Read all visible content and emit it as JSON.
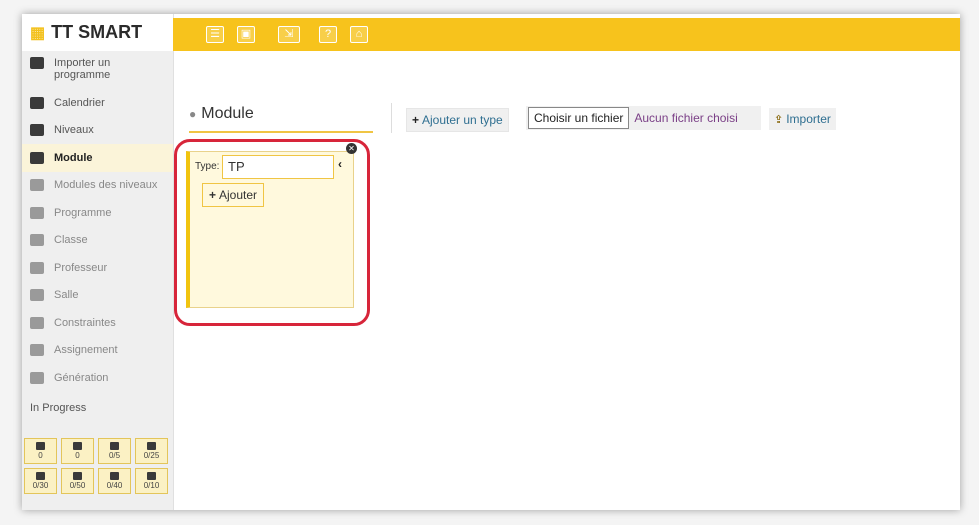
{
  "app": {
    "title": "TT SMART"
  },
  "sidebar": {
    "items": [
      {
        "label": "Importer un programme",
        "icon": "import-icon"
      },
      {
        "label": "Calendrier",
        "icon": "calendar-icon"
      },
      {
        "label": "Niveaux",
        "icon": "layers-icon"
      },
      {
        "label": "Module",
        "icon": "book-icon"
      },
      {
        "label": "Modules des niveaux",
        "icon": "sitemap-icon"
      },
      {
        "label": "Programme",
        "icon": "pen-icon"
      },
      {
        "label": "Classe",
        "icon": "users-icon"
      },
      {
        "label": "Professeur",
        "icon": "teacher-icon"
      },
      {
        "label": "Salle",
        "icon": "room-icon"
      },
      {
        "label": "Constraintes",
        "icon": "tools-icon"
      },
      {
        "label": "Assignement",
        "icon": "monitor-icon"
      },
      {
        "label": "Génération",
        "icon": "play-icon"
      }
    ],
    "progress_title": "In Progress",
    "progress": [
      {
        "icon": "calendar-icon",
        "value": "0"
      },
      {
        "icon": "calendar-icon",
        "value": "0"
      },
      {
        "icon": "layers-icon",
        "value": "0/5"
      },
      {
        "icon": "book-icon",
        "value": "0/25"
      },
      {
        "icon": "users-icon",
        "value": "0/30"
      },
      {
        "icon": "teacher-icon",
        "value": "0/50"
      },
      {
        "icon": "room-icon",
        "value": "0/40"
      },
      {
        "icon": "tools-icon",
        "value": "0/10"
      }
    ]
  },
  "toolbar": {
    "buttons": [
      {
        "icon": "menu-icon",
        "glyph": "☰"
      },
      {
        "icon": "save-icon",
        "glyph": "▣"
      },
      {
        "icon": "export-icon",
        "glyph": "⇲"
      },
      {
        "icon": "help-icon",
        "glyph": "?"
      },
      {
        "icon": "home-icon",
        "glyph": "⌂"
      }
    ]
  },
  "main": {
    "section_title": "Module",
    "add_type_label": "Ajouter un type",
    "file_button": "Choisir un fichier",
    "file_status": "Aucun fichier choisi",
    "import_label": "Importer",
    "card": {
      "type_label": "Type:",
      "type_value": "TP",
      "add_label": "Ajouter"
    }
  },
  "colors": {
    "accent": "#f7c31c",
    "highlight": "#d7253a",
    "link": "#2f6f91"
  }
}
